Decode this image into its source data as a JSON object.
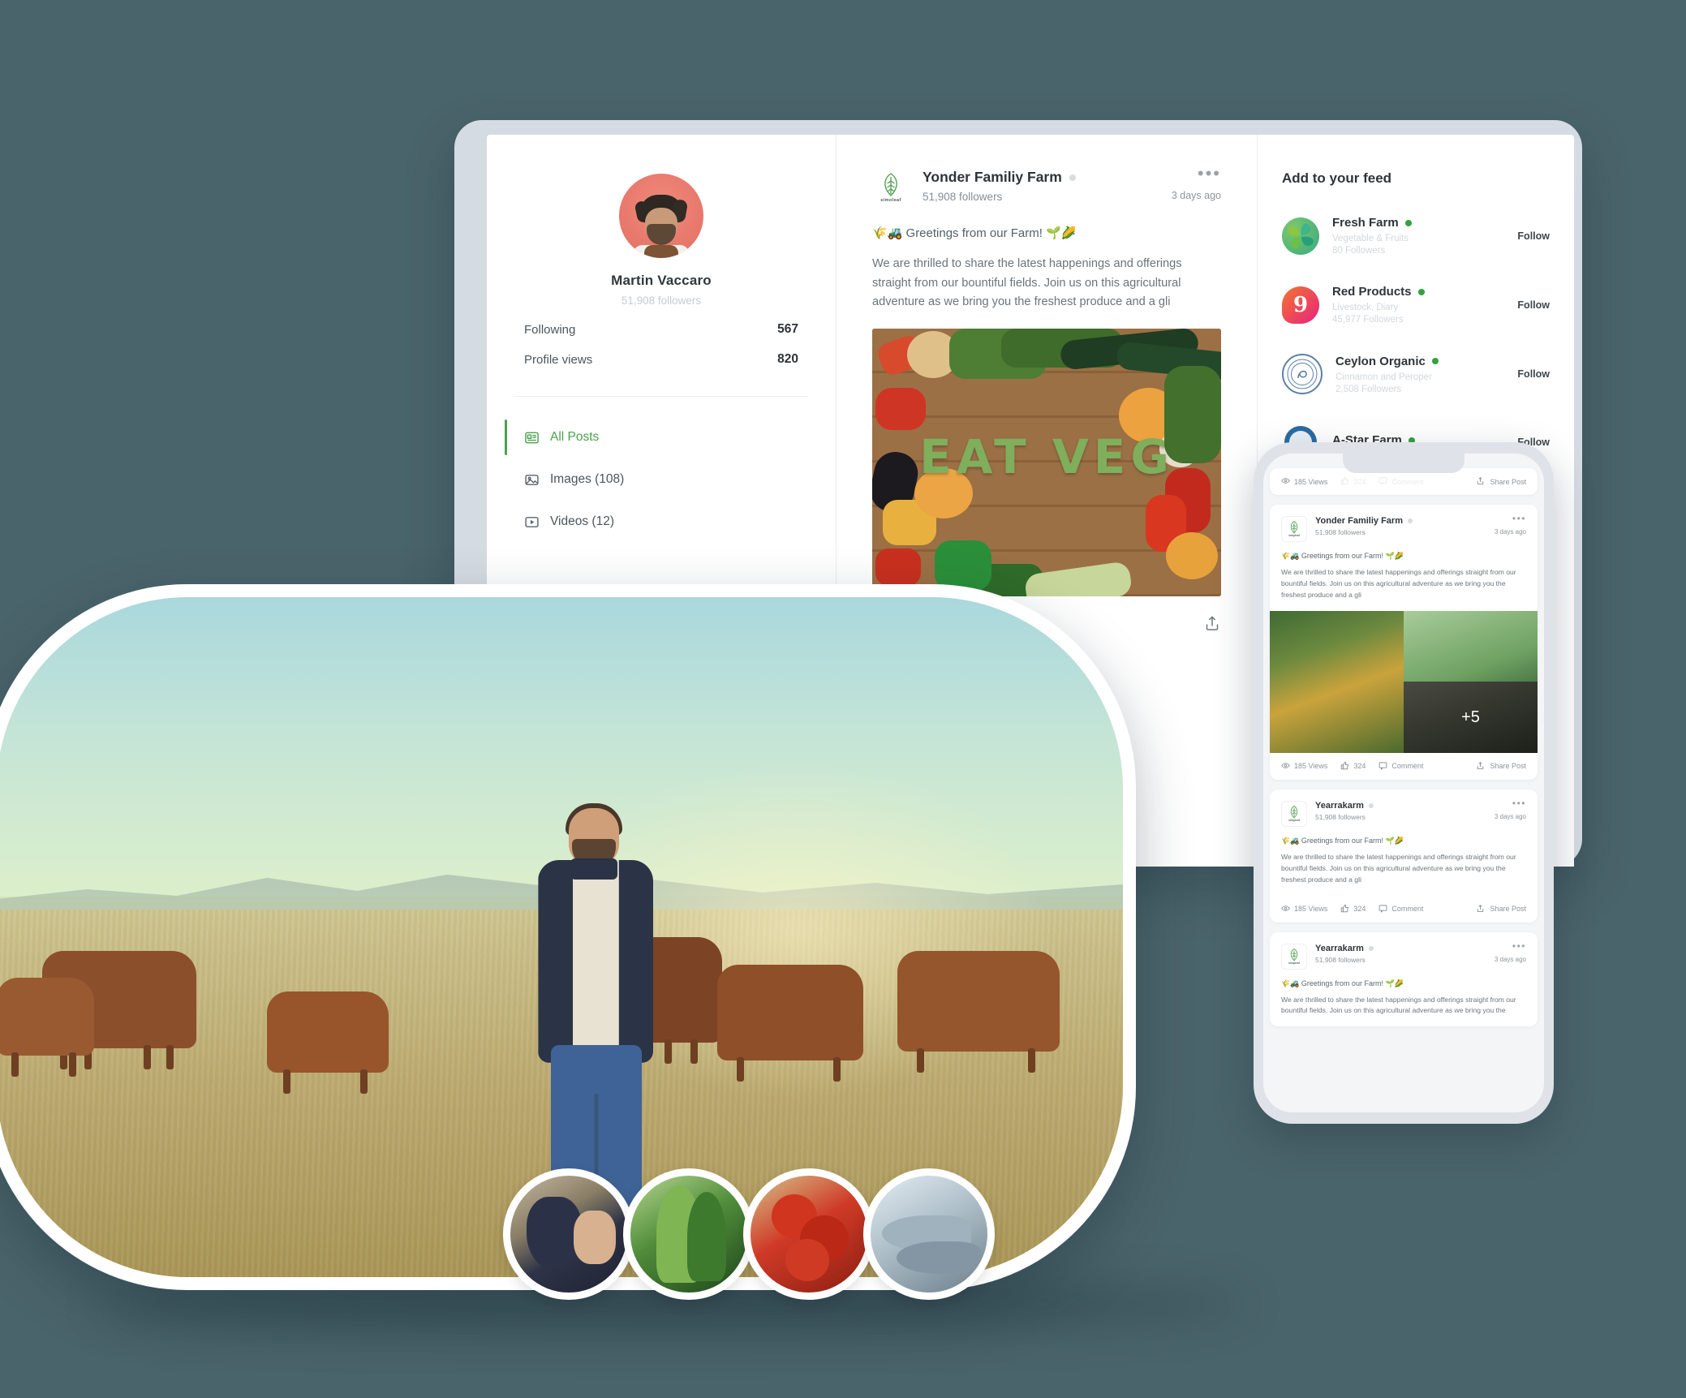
{
  "app": {
    "background_color": "#4a646b",
    "accent_green": "#4aa24e",
    "status_dot_green": "#36a03e"
  },
  "tablet": {
    "profile": {
      "name": "Martin Vaccaro",
      "followers": "51,908 followers",
      "avatar_icon": "user-avatar-photo",
      "stats": [
        {
          "label": "Following",
          "value": "567"
        },
        {
          "label": "Profile views",
          "value": "820"
        }
      ],
      "nav": [
        {
          "label": "All Posts",
          "icon": "all-posts-icon",
          "active": true
        },
        {
          "label": "Images (108)",
          "icon": "image-icon",
          "active": false
        },
        {
          "label": "Videos (12)",
          "icon": "video-icon",
          "active": false
        }
      ]
    },
    "post": {
      "brand_logo_text": "simoleaf",
      "author": "Yonder Familiy Farm",
      "followers": "51,908 followers",
      "time": "3 days ago",
      "menu_icon": "more-options-icon",
      "greeting": "🌾🚜 Greetings from our Farm! 🌱🌽",
      "body": "We are thrilled to share the latest happenings and offerings straight from our bountiful fields. Join us on this agricultural adventure as we bring you the freshest produce and a gli",
      "image_caption": "EAT VEG",
      "share_icon": "share-post-icon"
    },
    "feed": {
      "title": "Add to your feed",
      "follow_label": "Follow",
      "items": [
        {
          "name": "Fresh Farm",
          "desc": "Vegetable & Fruits",
          "followers": "80 Followers",
          "logo": "clover-logo",
          "logo_color": "#39a97e",
          "follow": "Follow"
        },
        {
          "name": "Red Products",
          "desc": "Livestock, Diary",
          "followers": "45,977 Followers",
          "logo": "nine-badge-logo",
          "logo_color": "#e8227e",
          "follow": "Follow"
        },
        {
          "name": "Ceylon Organic",
          "desc": "Cinnamon and Peroper",
          "followers": "2,508 Followers",
          "logo": "ceylon-seal-logo",
          "logo_color": "#5b80a8",
          "follow": "Follow"
        },
        {
          "name": "A-Star Farm",
          "desc": "",
          "followers": "",
          "logo": "a-star-badge-logo",
          "logo_color": "#2a6ca3",
          "follow": "Follow"
        }
      ]
    }
  },
  "phone": {
    "top_actionbar": {
      "views": "185 Views",
      "likes": "324",
      "comment": "Comment",
      "share": "Share Post",
      "views_icon": "eye-icon",
      "like_icon": "thumbs-up-icon",
      "comment_icon": "comment-icon",
      "share_icon": "share-icon"
    },
    "posts": [
      {
        "logo_text": "simpleaf",
        "author": "Yonder Familiy Farm",
        "followers": "51,908 followers",
        "time": "3 days ago",
        "greeting": "🌾🚜 Greetings from our Farm! 🌱🌽",
        "body": "We are thrilled to share the latest happenings and offerings straight from our bountiful fields. Join us on this agricultural adventure as we bring you the freshest produce and a gli",
        "gallery_overflow": "+5",
        "actionbar": {
          "views": "185 Views",
          "likes": "324",
          "comment": "Comment",
          "share": "Share Post"
        }
      },
      {
        "logo_text": "simpleaf",
        "author": "Yearrakarm",
        "followers": "51,908 followers",
        "time": "3 days ago",
        "greeting": "🌾🚜 Greetings from our Farm! 🌱🌽",
        "body": "We are thrilled to share the latest happenings and offerings straight from our bountiful fields. Join us on this agricultural adventure as we bring you the freshest produce and a gli",
        "actionbar": {
          "views": "185 Views",
          "likes": "324",
          "comment": "Comment",
          "share": "Share Post"
        }
      },
      {
        "logo_text": "simpleaf",
        "author": "Yearrakarm",
        "followers": "51,908 followers",
        "time": "3 days ago",
        "greeting": "🌾🚜 Greetings from our Farm! 🌱🌽",
        "body": "We are thrilled to share the latest happenings and offerings straight from our bountiful fields. Join us on this agricultural adventure as we bring you the"
      }
    ]
  },
  "hero": {
    "image_alt": "farmer-standing-in-field-with-cattle",
    "stories": [
      {
        "name": "story-grapes"
      },
      {
        "name": "story-greens"
      },
      {
        "name": "story-tomatoes"
      },
      {
        "name": "story-fish"
      }
    ]
  }
}
